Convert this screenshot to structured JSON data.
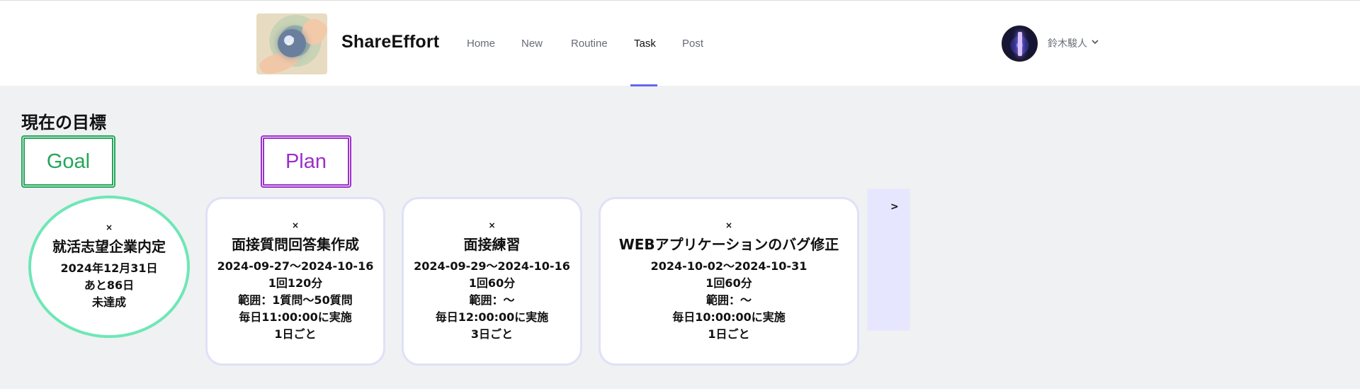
{
  "header": {
    "brand": "ShareEffort",
    "nav": [
      {
        "label": "Home"
      },
      {
        "label": "New"
      },
      {
        "label": "Routine"
      },
      {
        "label": "Task"
      },
      {
        "label": "Post"
      }
    ],
    "active_nav": "Task",
    "user": {
      "name": "鈴木駿人"
    }
  },
  "main": {
    "title": "現在の目標",
    "goal_label": "Goal",
    "plan_label": "Plan",
    "goal": {
      "close": "×",
      "title": "就活志望企業内定",
      "date": "2024年12月31日",
      "remaining": "あと86日",
      "status": "未達成"
    },
    "plans": [
      {
        "close": "×",
        "title": "面接質問回答集作成",
        "period": "2024-09-27〜2024-10-16",
        "per_session": "1回120分",
        "range": "範囲：1質問〜50質問",
        "schedule": "毎日11:00:00に実施",
        "interval": "1日ごと"
      },
      {
        "close": "×",
        "title": "面接練習",
        "period": "2024-09-29〜2024-10-16",
        "per_session": "1回60分",
        "range": "範囲：〜",
        "schedule": "毎日12:00:00に実施",
        "interval": "3日ごと"
      },
      {
        "close": "×",
        "title": "WEBアプリケーションのバグ修正",
        "period": "2024-10-02〜2024-10-31",
        "per_session": "1回60分",
        "range": "範囲：〜",
        "schedule": "毎日10:00:00に実施",
        "interval": "1日ごと"
      }
    ],
    "next_label": ">"
  },
  "colors": {
    "goal": "#22a55a",
    "plan": "#9b2fc9",
    "goal_circle_border": "#6ee7b7",
    "nav_active_underline": "#6366f1",
    "next_panel": "#e6e6ff"
  },
  "icons": {
    "logo": "hands-orb-logo",
    "avatar": "tower-night-avatar",
    "dropdown": "chevron-down-icon"
  }
}
